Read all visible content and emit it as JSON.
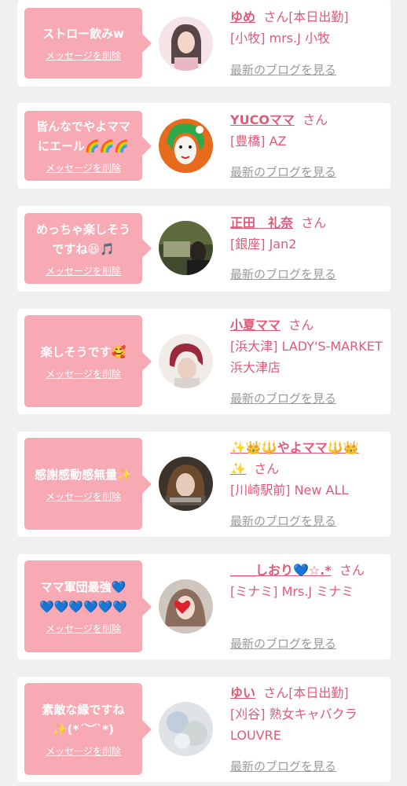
{
  "delete_label": "メッセージを削除",
  "blog_label": "最新のブログを見る",
  "colors": {
    "bubble": "#f7a9b4",
    "accent": "#e05a78",
    "muted": "#9a9a9a",
    "card": "#ffffff",
    "background": "#f0f0f0"
  },
  "items": [
    {
      "message": "ストロー飲みw",
      "name": "ゆめ",
      "suffix": "さん[本日出勤]",
      "shop": "[小牧] mrs.J 小牧"
    },
    {
      "message": "皆んなでやよママ\nにエール🌈🌈🌈",
      "name": "YUCOママ",
      "suffix": "さん",
      "shop": "[豊橋] AZ"
    },
    {
      "message": "めっちゃ楽しそう\nですね😆🎵",
      "name": "正田　礼奈",
      "suffix": "さん",
      "shop": "[銀座] Jan2"
    },
    {
      "message": "楽しそうです🥰",
      "name": "小夏ママ",
      "suffix": "さん",
      "shop": "[浜大津] LADY'S-MARKET 浜大津店"
    },
    {
      "message": "感謝感動感無量✨",
      "name": "✨👑🔱やよママ🔱👑✨",
      "suffix": "さん",
      "shop": "[川崎駅前] New ALL"
    },
    {
      "message": "ママ軍団最強💙\n💙💙💙💙💙💙",
      "name": "＿＿しおり💙☆.*",
      "suffix": "さん",
      "shop": "[ミナミ] Mrs.J ミナミ"
    },
    {
      "message": "素敵な縁ですね\n✨(*´︶`*)",
      "name": "ゆい",
      "suffix": "さん[本日出勤]",
      "shop": "[刈谷] 熟女キャバクラLOUVRE"
    }
  ]
}
